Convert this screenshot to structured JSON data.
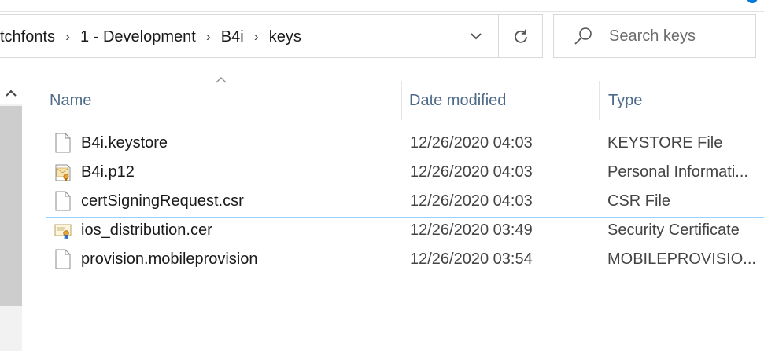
{
  "breadcrumbs": [
    "tchfonts",
    "1 - Development",
    "B4i",
    "keys"
  ],
  "search": {
    "placeholder": "Search keys"
  },
  "columns": {
    "name": "Name",
    "date": "Date modified",
    "type": "Type"
  },
  "files": [
    {
      "name": "B4i.keystore",
      "date": "12/26/2020 04:03",
      "type": "KEYSTORE File",
      "icon": "file-icon"
    },
    {
      "name": "B4i.p12",
      "date": "12/26/2020 04:03",
      "type": "Personal Informati...",
      "icon": "personal-info-exchange-icon"
    },
    {
      "name": "certSigningRequest.csr",
      "date": "12/26/2020 04:03",
      "type": "CSR File",
      "icon": "file-icon"
    },
    {
      "name": "ios_distribution.cer",
      "date": "12/26/2020 03:49",
      "type": "Security Certificate",
      "icon": "certificate-icon"
    },
    {
      "name": "provision.mobileprovision",
      "date": "12/26/2020 03:54",
      "type": "MOBILEPROVISIO...",
      "icon": "file-icon"
    }
  ],
  "colors": {
    "accent": "#0078d7",
    "header_text": "#4d6a88",
    "selection_border": "#99d1ff"
  }
}
